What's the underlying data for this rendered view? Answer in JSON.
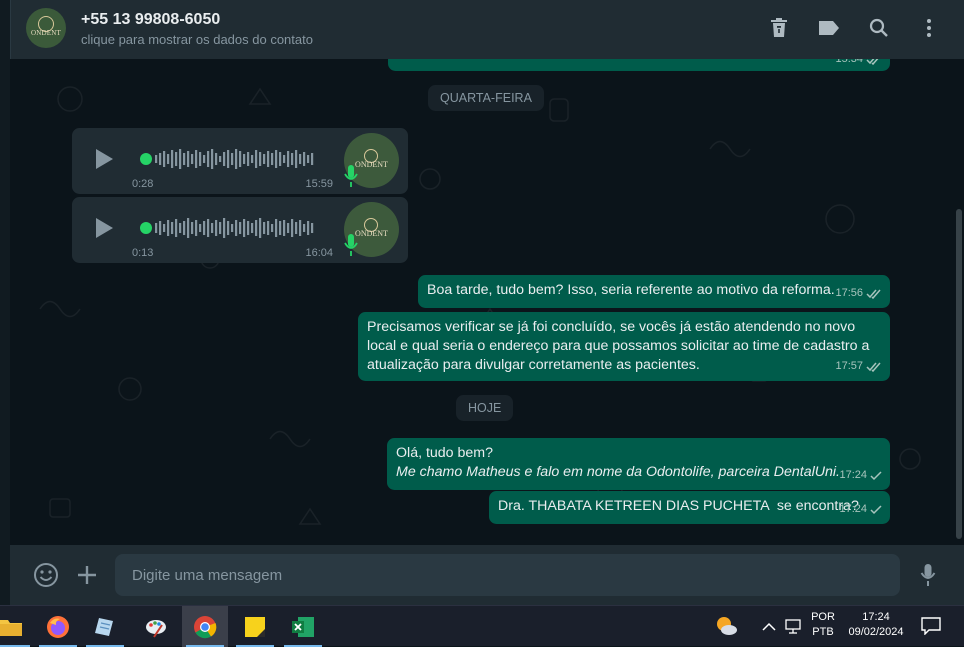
{
  "header": {
    "avatar_brand": "ONDENT",
    "contact_name": "+55 13 99808-6050",
    "contact_subtitle": "clique para mostrar os dados do contato",
    "icons": [
      "delete-icon",
      "label-icon",
      "search-icon",
      "menu-icon"
    ]
  },
  "chat": {
    "top_bubble_time": "15:34",
    "date_wednesday": "QUARTA-FEIRA",
    "audio_messages": [
      {
        "duration": "0:28",
        "time": "15:59",
        "avatar_brand": "ONDENT"
      },
      {
        "duration": "0:13",
        "time": "16:04",
        "avatar_brand": "ONDENT"
      }
    ],
    "messages_wed": [
      {
        "text": "Boa tarde, tudo bem? Isso, seria referente ao motivo da reforma.",
        "time": "17:56",
        "status": "read"
      },
      {
        "text": "Precisamos verificar se já foi concluído, se vocês já estão atendendo no novo local e qual seria o endereço para que possamos solicitar ao time de cadastro a atualização para divulgar corretamente as pacientes.",
        "time": "17:57",
        "status": "read"
      }
    ],
    "date_today": "HOJE",
    "messages_today": [
      {
        "line1": "Olá, tudo bem?",
        "line2": "Me chamo Matheus e falo em nome da Odontolife, parceira DentalUni.",
        "time": "17:24",
        "status": "sent"
      },
      {
        "text": "Dra. THABATA KETREEN DIAS PUCHETA  se encontra?",
        "time": "17:24",
        "status": "sent"
      }
    ]
  },
  "composer": {
    "placeholder": "Digite uma mensagem"
  },
  "taskbar": {
    "apps": [
      "file-explorer",
      "firefox",
      "notepad",
      "paint",
      "chrome",
      "sticky-notes",
      "excel"
    ],
    "language_line1": "POR",
    "language_line2": "PTB",
    "time": "17:24",
    "date": "09/02/2024"
  },
  "colors": {
    "outgoing_bubble": "#005c4b",
    "header": "#202c33",
    "background": "#0b141a",
    "accent_green": "#25d366"
  }
}
